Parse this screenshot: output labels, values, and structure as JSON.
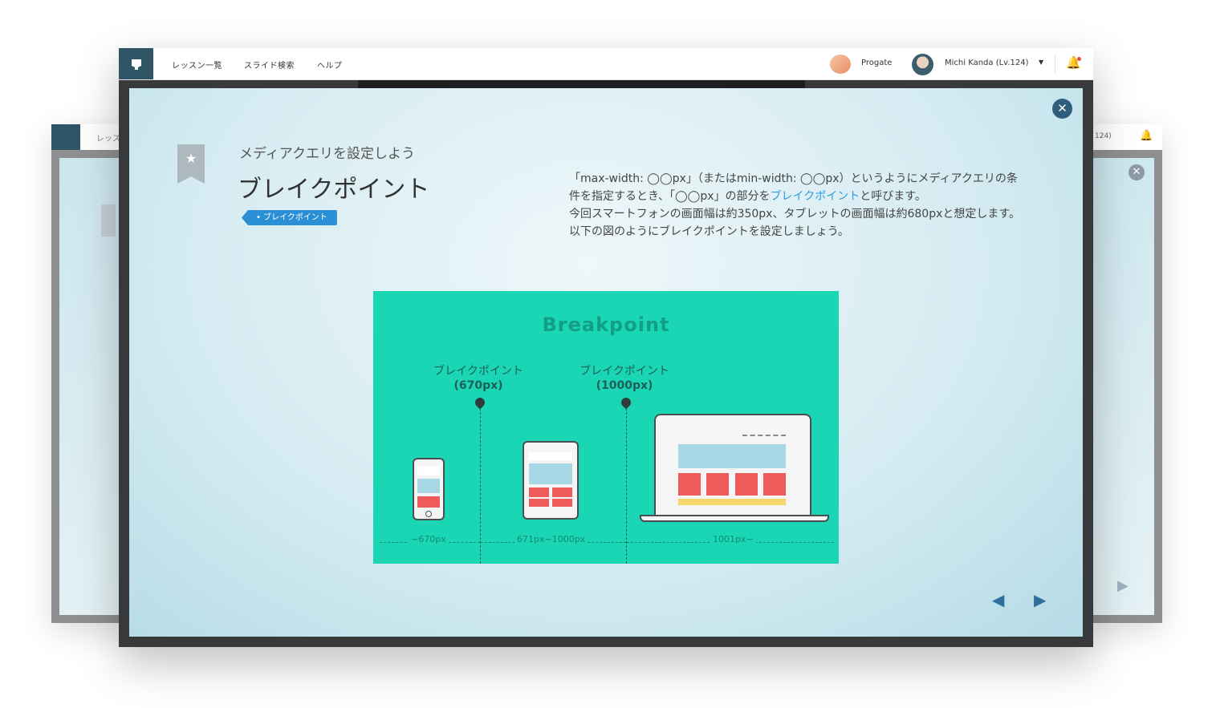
{
  "nav": {
    "links": [
      "レッスン一覧",
      "スライド検索",
      "ヘルプ"
    ],
    "progate": "Progate",
    "user": "Michi Kanda (Lv.124)"
  },
  "bg_window": {
    "left_tab_text": "レッス",
    "right_level_text": "124)"
  },
  "slide": {
    "subtitle": "メディアクエリを設定しよう",
    "title": "ブレイクポイント",
    "tag": "• ブレイクポイント",
    "desc_1": "「max-width: ◯◯px」（またはmin-width: ◯◯px）というようにメディアクエリの条件を指定するとき、「◯◯px」の部分を",
    "desc_highlight": "ブレイクポイント",
    "desc_2": "と呼びます。",
    "desc_3": "今回スマートフォンの画面幅は約350px、タブレットの画面幅は約680pxと想定します。以下の図のようにブレイクポイントを設定しましょう。"
  },
  "diagram": {
    "title": "Breakpoint",
    "bp1_label": "ブレイクポイント",
    "bp1_value": "(670px)",
    "bp2_label": "ブレイクポイント",
    "bp2_value": "(1000px)",
    "range1": "~670px",
    "range2": "671px~1000px",
    "range3": "1001px~"
  },
  "colors": {
    "diagram_bg": "#1ad6b4",
    "accent_blue": "#2e9ce0",
    "logo_bg": "#2f5566"
  },
  "icons": [
    "logo-icon",
    "chevron-down-icon",
    "bell-icon",
    "close-icon",
    "star-icon",
    "left-arrow-icon",
    "right-arrow-icon"
  ]
}
